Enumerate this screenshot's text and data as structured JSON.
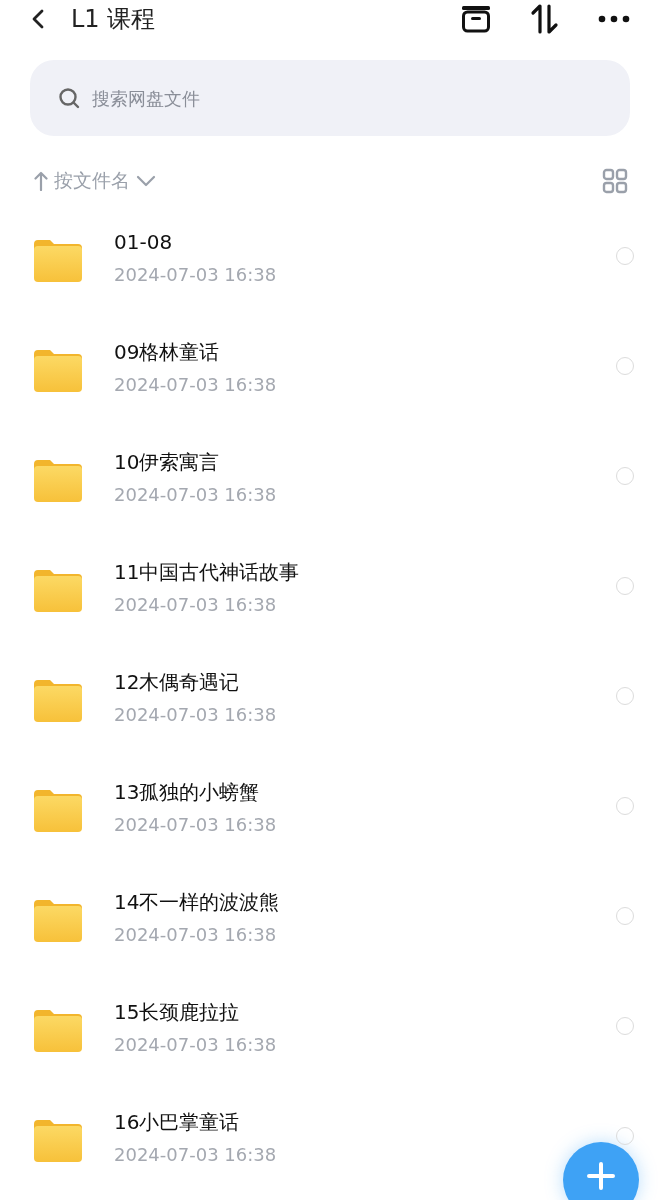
{
  "header": {
    "title": "L1 课程"
  },
  "search": {
    "placeholder": "搜索网盘文件"
  },
  "sort": {
    "label": "按文件名"
  },
  "files": [
    {
      "name": "01-08",
      "date": "2024-07-03  16:38",
      "selected": false
    },
    {
      "name": "09格林童话",
      "date": "2024-07-03  16:38",
      "selected": false
    },
    {
      "name": "10伊索寓言",
      "date": "2024-07-03  16:38",
      "selected": false
    },
    {
      "name": "11中国古代神话故事",
      "date": "2024-07-03  16:38",
      "selected": false
    },
    {
      "name": "12木偶奇遇记",
      "date": "2024-07-03  16:38",
      "selected": false
    },
    {
      "name": "13孤独的小螃蟹",
      "date": "2024-07-03  16:38",
      "selected": false
    },
    {
      "name": "14不一样的波波熊",
      "date": "2024-07-03  16:38",
      "selected": false
    },
    {
      "name": "15长颈鹿拉拉",
      "date": "2024-07-03  16:38",
      "selected": false
    },
    {
      "name": "16小巴掌童话",
      "date": "2024-07-03  16:38",
      "selected": false
    }
  ]
}
